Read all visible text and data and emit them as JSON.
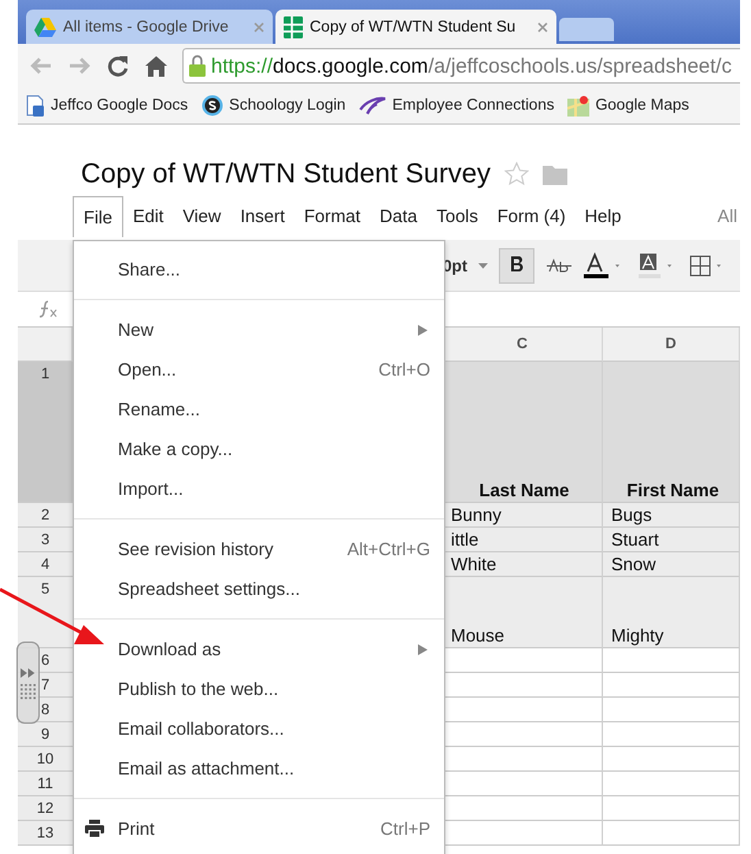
{
  "browser": {
    "tabs": [
      {
        "title": "All items - Google Drive",
        "kind": "drive",
        "selected": false
      },
      {
        "title": "Copy of WT/WTN Student Su",
        "kind": "sheet",
        "selected": true
      }
    ],
    "address": {
      "scheme": "https://",
      "host": "docs.google.com",
      "path": "/a/jeffcoschools.us/spreadsheet/c"
    },
    "bookmarks": [
      {
        "label": "Jeffco Google Docs",
        "kind": "doc"
      },
      {
        "label": "Schoology Login",
        "kind": "schoology"
      },
      {
        "label": "Employee Connections",
        "kind": "swoosh"
      },
      {
        "label": "Google Maps",
        "kind": "maps"
      }
    ]
  },
  "document": {
    "title": "Copy of WT/WTN Student Survey",
    "starred": false,
    "menu_bar": [
      {
        "label": "File",
        "selected": true
      },
      {
        "label": "Edit",
        "selected": false
      },
      {
        "label": "View",
        "selected": false
      },
      {
        "label": "Insert",
        "selected": false
      },
      {
        "label": "Format",
        "selected": false
      },
      {
        "label": "Data",
        "selected": false
      },
      {
        "label": "Tools",
        "selected": false
      },
      {
        "label": "Form (4)",
        "selected": false
      },
      {
        "label": "Help",
        "selected": false
      }
    ],
    "save_status": "All",
    "toolbar": {
      "font_size": "0pt",
      "bold": true
    }
  },
  "sheet": {
    "columns": [
      "C",
      "D"
    ],
    "rows": [
      {
        "number": "1",
        "kind": "header",
        "cells": [
          "Last Name",
          "First Name"
        ]
      },
      {
        "number": "2",
        "kind": "entry",
        "cells": [
          "Bunny",
          "Bugs"
        ]
      },
      {
        "number": "3",
        "kind": "entry",
        "cells": [
          "ittle",
          "Stuart"
        ]
      },
      {
        "number": "4",
        "kind": "entry",
        "cells": [
          "White",
          "Snow"
        ]
      },
      {
        "number": "5",
        "kind": "tall",
        "cells": [
          "Mouse",
          "Mighty"
        ]
      },
      {
        "number": "6",
        "kind": "blank",
        "cells": []
      },
      {
        "number": "7",
        "kind": "blank",
        "cells": []
      },
      {
        "number": "8",
        "kind": "blank",
        "cells": []
      },
      {
        "number": "9",
        "kind": "blank",
        "cells": []
      },
      {
        "number": "10",
        "kind": "blank",
        "cells": []
      },
      {
        "number": "11",
        "kind": "blank",
        "cells": []
      },
      {
        "number": "12",
        "kind": "blank",
        "cells": []
      },
      {
        "number": "13",
        "kind": "blank",
        "cells": []
      }
    ]
  },
  "file_menu": [
    [
      {
        "label": "Share...",
        "kind": "plain"
      }
    ],
    [
      {
        "label": "New",
        "kind": "submenu"
      },
      {
        "label": "Open...",
        "kind": "plain",
        "shortcut": "Ctrl+O"
      },
      {
        "label": "Rename...",
        "kind": "plain"
      },
      {
        "label": "Make a copy...",
        "kind": "plain"
      },
      {
        "label": "Import...",
        "kind": "plain"
      }
    ],
    [
      {
        "label": "See revision history",
        "kind": "plain",
        "shortcut": "Alt+Ctrl+G"
      },
      {
        "label": "Spreadsheet settings...",
        "kind": "plain"
      }
    ],
    [
      {
        "label": "Download as",
        "kind": "submenu"
      },
      {
        "label": "Publish to the web...",
        "kind": "plain"
      },
      {
        "label": "Email collaborators...",
        "kind": "plain"
      },
      {
        "label": "Email as attachment...",
        "kind": "plain"
      }
    ],
    [
      {
        "label": "Print",
        "kind": "print",
        "shortcut": "Ctrl+P"
      }
    ]
  ]
}
